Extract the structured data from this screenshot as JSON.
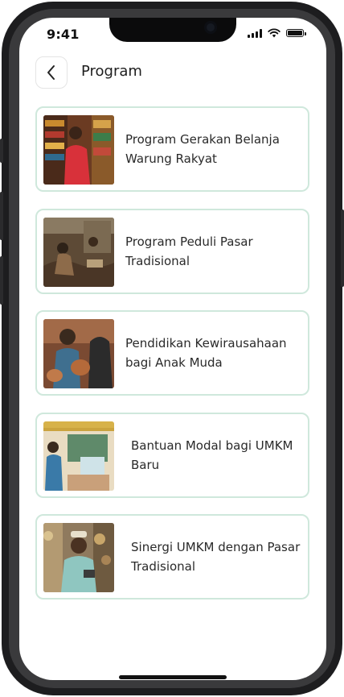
{
  "status_bar": {
    "time": "9:41"
  },
  "header": {
    "title": "Program"
  },
  "programs": [
    {
      "label": "Program Gerakan Belanja Warung Rakyat"
    },
    {
      "label": "Program Peduli Pasar Tradisional"
    },
    {
      "label": "Pendidikan Kewirausahaan bagi Anak Muda"
    },
    {
      "label": "Bantuan Modal bagi UMKM Baru"
    },
    {
      "label": "Sinergi UMKM dengan Pasar Tradisional"
    }
  ],
  "icons": {
    "back": "chevron-left-icon",
    "signal": "cellular-signal-icon",
    "wifi": "wifi-icon",
    "battery": "battery-icon"
  },
  "colors": {
    "card_border": "#cfe8dc",
    "text": "#2a2a2a",
    "background": "#ffffff"
  }
}
